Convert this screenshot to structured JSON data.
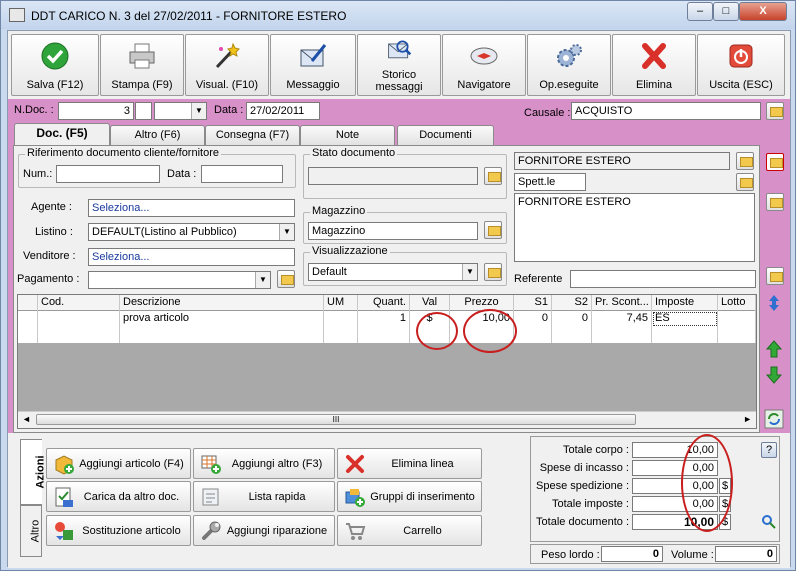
{
  "window": {
    "title": "DDT CARICO N. 3  del 27/02/2011 - FORNITORE ESTERO",
    "minimize": "–",
    "maximize": "□",
    "close": "X"
  },
  "toolbar": {
    "buttons": [
      {
        "label": "Salva (F12)",
        "icon": "check-icon"
      },
      {
        "label": "Stampa (F9)",
        "icon": "printer-icon"
      },
      {
        "label": "Visual. (F10)",
        "icon": "magic-wand-icon"
      },
      {
        "label": "Messaggio",
        "icon": "envelope-pen-icon"
      },
      {
        "label": "Storico messaggi",
        "icon": "envelope-search-icon"
      },
      {
        "label": "Navigatore",
        "icon": "compass-icon"
      },
      {
        "label": "Op.eseguite",
        "icon": "gears-icon"
      },
      {
        "label": "Elimina",
        "icon": "red-x-icon"
      },
      {
        "label": "Uscita (ESC)",
        "icon": "power-icon"
      }
    ]
  },
  "header": {
    "ndoc_label": "N.Doc. :",
    "ndoc_value": "3",
    "data_label": "Data :",
    "data_value": "27/02/2011",
    "causale_label": "Causale :",
    "causale_value": "ACQUISTO"
  },
  "tabs": [
    "Doc. (F5)",
    "Altro (F6)",
    "Consegna (F7)",
    "Note",
    "Documenti"
  ],
  "doc": {
    "rif_title": "Riferimento documento cliente/fornitore",
    "num_label": "Num.:",
    "data_label": "Data :",
    "stato_title": "Stato documento",
    "magazzino_title": "Magazzino",
    "magazzino_value": "Magazzino",
    "visual_title": "Visualizzazione",
    "visual_value": "Default",
    "agente_label": "Agente :",
    "agente_value": "Seleziona...",
    "listino_label": "Listino :",
    "listino_value": "DEFAULT(Listino al Pubblico)",
    "venditore_label": "Venditore :",
    "venditore_value": "Seleziona...",
    "pagamento_label": "Pagamento :",
    "fornitore_name": "FORNITORE ESTERO",
    "spett_value": "Spett.le",
    "address_text": "FORNITORE ESTERO",
    "referente_label": "Referente"
  },
  "grid": {
    "columns": [
      "Cod.",
      "Descrizione",
      "UM",
      "Quant.",
      "Val",
      "Prezzo",
      "S1",
      "S2",
      "Pr. Scont...",
      "Imposte",
      "Lotto"
    ],
    "rows": [
      {
        "cod": "",
        "descrizione": "prova articolo",
        "um": "",
        "quant": "1",
        "val": "$",
        "prezzo": "10,00",
        "s1": "0",
        "s2": "0",
        "pr_scont": "7,45",
        "imposte": "ES",
        "lotto": ""
      }
    ],
    "scroll_grip": "III"
  },
  "side_tabs": {
    "azioni": "Azioni",
    "altro": "Altro"
  },
  "actions": [
    {
      "label": "Aggiungi articolo (F4)",
      "icon": "add-box-icon"
    },
    {
      "label": "Aggiungi altro (F3)",
      "icon": "add-grid-icon"
    },
    {
      "label": "Elimina linea",
      "icon": "delete-line-icon"
    },
    {
      "label": "Carica da altro doc.",
      "icon": "load-doc-icon"
    },
    {
      "label": "Lista rapida",
      "icon": "quick-list-icon"
    },
    {
      "label": "Gruppi di inserimento",
      "icon": "group-insert-icon"
    },
    {
      "label": "Sostituzione articolo",
      "icon": "replace-item-icon"
    },
    {
      "label": "Aggiungi riparazione",
      "icon": "wrench-icon"
    },
    {
      "label": "Carrello",
      "icon": "cart-icon"
    }
  ],
  "totals": {
    "totale_corpo_label": "Totale corpo :",
    "totale_corpo": "10,00",
    "spese_incasso_label": "Spese di incasso :",
    "spese_incasso": "0,00",
    "spese_spedizione_label": "Spese spedizione :",
    "spese_spedizione": "0,00",
    "totale_imposte_label": "Totale imposte :",
    "totale_imposte": "0,00",
    "totale_documento_label": "Totale documento :",
    "totale_documento": "10,00",
    "currency": "$",
    "help": "?",
    "peso_label": "Peso lordo :",
    "peso_value": "0",
    "volume_label": "Volume :",
    "volume_value": "0"
  },
  "colors": {
    "pink": "#d890c8",
    "highlight": "#c81e1e"
  }
}
